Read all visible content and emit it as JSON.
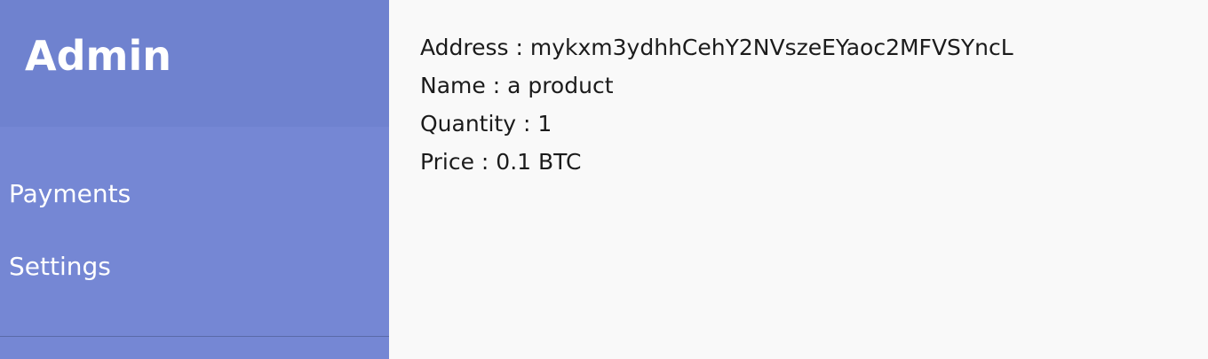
{
  "sidebar": {
    "title": "Admin",
    "items": [
      {
        "label": "Payments"
      },
      {
        "label": "Settings"
      }
    ]
  },
  "payment": {
    "address": "Address : mykxm3ydhhCehY2NVszeEYaoc2MFVSYncL",
    "name": "Name : a product",
    "quantity": "Quantity : 1",
    "price": "Price : 0.1 BTC"
  },
  "colors": {
    "sidebar_bg": "#7587d4",
    "sidebar_header_bg": "#6f82cf",
    "main_bg": "#f9f9f9",
    "text": "#1b1b1b"
  }
}
